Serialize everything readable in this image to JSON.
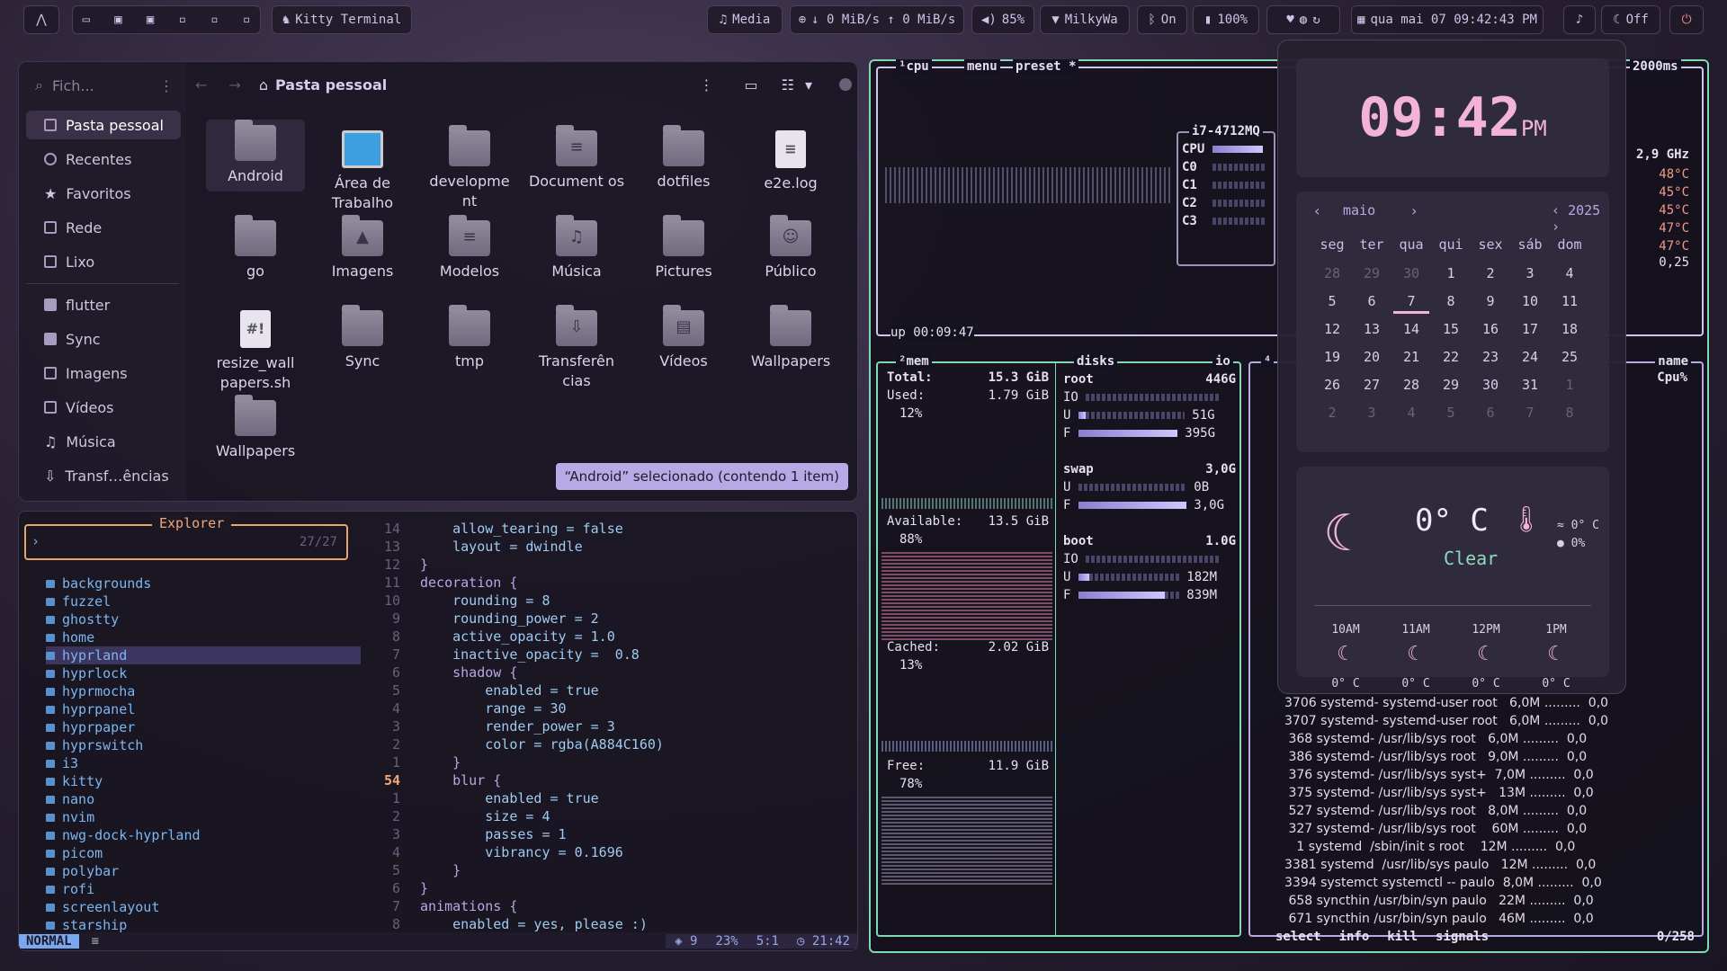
{
  "topbar": {
    "terminal_label": "Kitty Terminal",
    "media": "Media",
    "network": "↓ 0 MiB/s ↑ 0 MiB/s",
    "volume": "85%",
    "wifi": "MilkyWa",
    "bluetooth": "On",
    "battery": "100%",
    "datetime": "qua mai 07  09:42:43 PM",
    "night": "Off"
  },
  "filemanager": {
    "search": "Fich...",
    "path": "Pasta pessoal",
    "sidebar": [
      "Pasta pessoal",
      "Recentes",
      "Favoritos",
      "Rede",
      "Lixo",
      "flutter",
      "Sync",
      "Imagens",
      "Vídeos",
      "Música",
      "Transf…ências"
    ],
    "items": [
      "Android",
      "Área de Trabalho",
      "developme nt",
      "Document os",
      "dotfiles",
      "e2e.log",
      "go",
      "Imagens",
      "Modelos",
      "Música",
      "Pictures",
      "Público",
      "resize_wall papers.sh",
      "Sync",
      "tmp",
      "Transferên cias",
      "Vídeos",
      "Wallpapers",
      "Wallpapers"
    ],
    "status": "“Android” selecionado (contendo 1 item)"
  },
  "editor": {
    "explorer_title": "Explorer",
    "count": "27/27",
    "tree": [
      "backgrounds",
      "fuzzel",
      "ghostty",
      "home",
      "hyprland",
      "hyprlock",
      "hyprmocha",
      "hyprpanel",
      "hyprpaper",
      "hyprswitch",
      "i3",
      "kitty",
      "nano",
      "nvim",
      "nwg-dock-hyprland",
      "picom",
      "polybar",
      "rofi",
      "screenlayout",
      "starship"
    ],
    "line_numbers": [
      "14",
      "13",
      "12",
      "11",
      "10",
      "9",
      "8",
      "7",
      "6",
      "5",
      "4",
      "3",
      "2",
      "1",
      "54",
      "1",
      "2",
      "3",
      "4",
      "5",
      "6",
      "7",
      "8"
    ],
    "code": [
      "    allow_tearing = false",
      "    layout = dwindle",
      "}",
      "decoration {",
      "    rounding = 8",
      "    rounding_power = 2",
      "    active_opacity = 1.0",
      "    inactive_opacity =  0.8",
      "    shadow {",
      "        enabled = true",
      "        range = 30",
      "        render_power = 3",
      "        color = rgba(A884C160)",
      "    }",
      "    blur {",
      "        enabled = true",
      "        size = 4",
      "        passes = 1",
      "        vibrancy = 0.1696",
      "    }",
      "}",
      "animations {",
      "    enabled = yes, please :)"
    ],
    "mode": "NORMAL",
    "status_git": "9",
    "status_pct": "23%",
    "status_pos": "5:1",
    "status_time": "21:42"
  },
  "btop": {
    "cpu_tab": "cpu",
    "menu": "menu",
    "preset": "preset *",
    "refresh": "2000ms",
    "cpu_model": "i7-4712MQ",
    "freq": "2,9 GHz",
    "cores": [
      "CPU",
      "C0",
      "C1",
      "C2",
      "C3"
    ],
    "temps": [
      "48°C",
      "45°C",
      "45°C",
      "47°C",
      "47°C"
    ],
    "load": "0,25",
    "uptime": "up 00:09:47",
    "mem": {
      "title": "mem",
      "total_label": "Total:",
      "total": "15.3 GiB",
      "used_label": "Used:",
      "used": "1.79 GiB",
      "used_pct": "12%",
      "avail_label": "Available:",
      "avail": "13.5 GiB",
      "avail_pct": "88%",
      "cached_label": "Cached:",
      "cached": "2.02 GiB",
      "cached_pct": "13%",
      "free_label": "Free:",
      "free": "11.9 GiB",
      "free_pct": "78%"
    },
    "disks": {
      "title": "disks",
      "io": "io",
      "root": "root",
      "root_size": "446G",
      "root_u": "51G",
      "root_f": "395G",
      "swap": "swap",
      "swap_size": "3,0G",
      "swap_u": "0B",
      "swap_f": "3,0G",
      "boot": "boot",
      "boot_size": "1.0G",
      "boot_u": "182M",
      "boot_f": "839M"
    },
    "proc_header": "Cpu%",
    "proc_name": "name",
    "processes": [
      "3706 systemd- systemd-user root   6,0M .........  0,0",
      "3707 systemd- systemd-user root   6,0M .........  0,0",
      " 368 systemd- /usr/lib/sys root   6,0M .........  0,0",
      " 386 systemd- /usr/lib/sys root   9,0M .........  0,0",
      " 376 systemd- /usr/lib/sys syst+  7,0M .........  0,0",
      " 375 systemd- /usr/lib/sys syst+   13M .........  0,0",
      " 527 systemd- /usr/lib/sys root   8,0M .........  0,0",
      " 327 systemd- /usr/lib/sys root    60M .........  0,0",
      "   1 systemd  /sbin/init s root    12M .........  0,0",
      "3381 systemd  /usr/lib/sys paulo   12M .........  0,0",
      "3394 systemct systemctl -- paulo  8,0M .........  0,0",
      " 658 syncthin /usr/bin/syn paulo   22M .........  0,0",
      " 671 syncthin /usr/bin/syn paulo   46M .........  0,0"
    ],
    "footer": [
      "select",
      "info",
      "kill",
      "signals"
    ],
    "proc_count": "0/258"
  },
  "widget": {
    "time": "09:42",
    "ampm": "PM",
    "month": "maio",
    "year": "2025",
    "weekdays": [
      "seg",
      "ter",
      "qua",
      "qui",
      "sex",
      "sáb",
      "dom"
    ],
    "days": [
      "28",
      "29",
      "30",
      "1",
      "2",
      "3",
      "4",
      "5",
      "6",
      "7",
      "8",
      "9",
      "10",
      "11",
      "12",
      "13",
      "14",
      "15",
      "16",
      "17",
      "18",
      "19",
      "20",
      "21",
      "22",
      "23",
      "24",
      "25",
      "26",
      "27",
      "28",
      "29",
      "30",
      "31",
      "1",
      "2",
      "3",
      "4",
      "5",
      "6",
      "7",
      "8"
    ],
    "today_index": 9,
    "temp": "0° C",
    "condition": "Clear",
    "feels": "0° C",
    "precip": "0%",
    "hours": [
      "10AM",
      "11AM",
      "12PM",
      "1PM"
    ],
    "hour_temps": [
      "0° C",
      "0° C",
      "0° C",
      "0° C"
    ]
  }
}
